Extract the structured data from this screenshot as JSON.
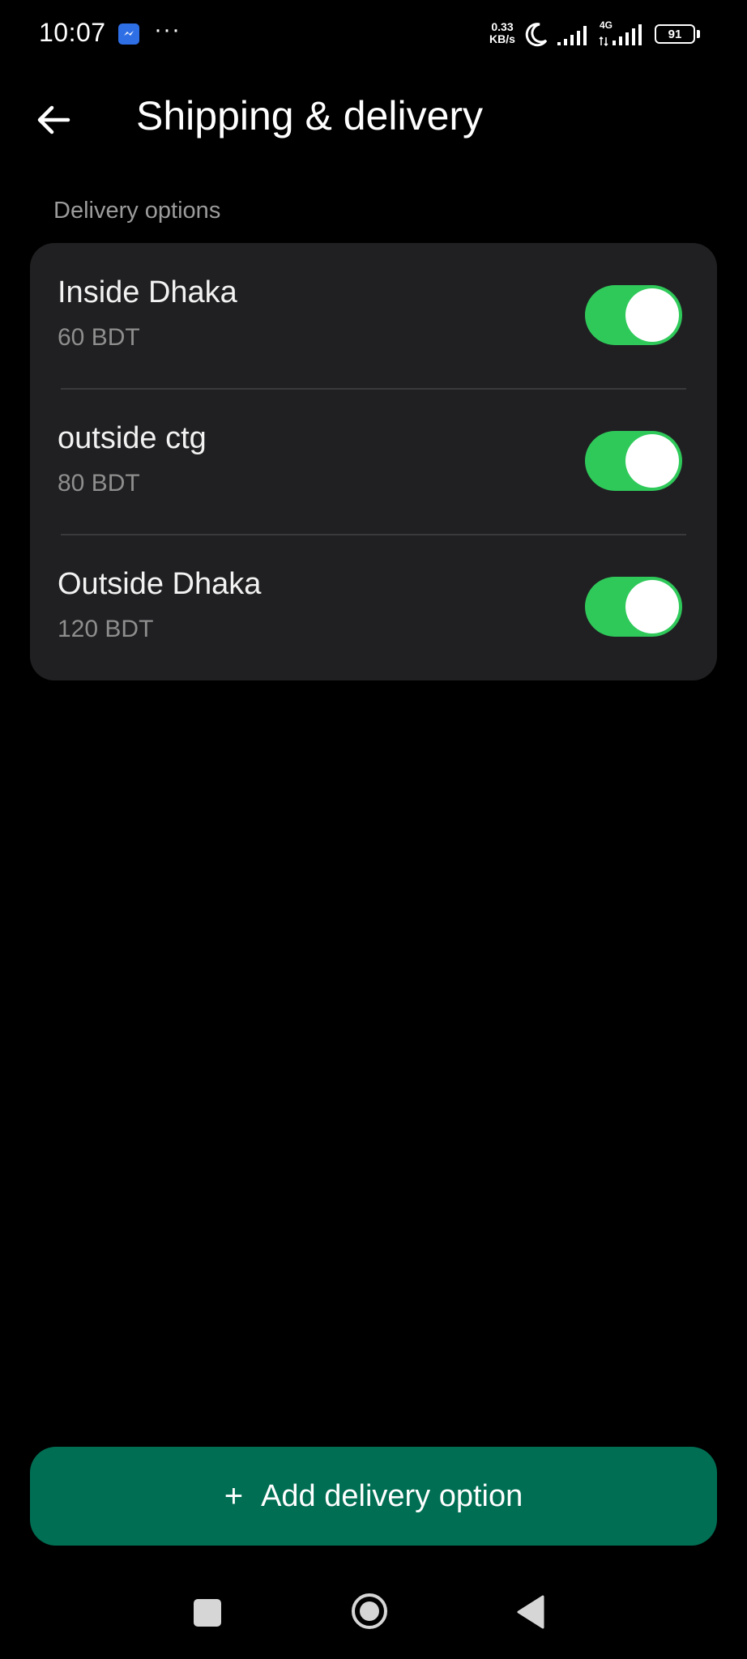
{
  "status_bar": {
    "time": "10:07",
    "more": "···",
    "net_speed_value": "0.33",
    "net_speed_unit": "KB/s",
    "net_type": "4G",
    "battery": "91"
  },
  "header": {
    "title": "Shipping & delivery"
  },
  "delivery": {
    "section_label": "Delivery options",
    "options": [
      {
        "name": "Inside Dhaka",
        "price": "60 BDT",
        "enabled": true
      },
      {
        "name": "outside ctg",
        "price": "80 BDT",
        "enabled": true
      },
      {
        "name": "Outside Dhaka",
        "price": "120 BDT",
        "enabled": true
      }
    ]
  },
  "actions": {
    "add_plus": "+",
    "add_label": "Add delivery option"
  },
  "colors": {
    "background": "#000000",
    "card": "#202022",
    "toggle_on": "#2fc95a",
    "primary_button": "#006e53",
    "secondary_text": "#8e8e8e"
  },
  "icons": {
    "back": "arrow-left-icon",
    "messenger": "messenger-icon",
    "moon": "moon-icon",
    "signal": "signal-icon",
    "battery": "battery-icon",
    "nav_recents": "square-icon",
    "nav_home": "circle-icon",
    "nav_back": "triangle-icon"
  }
}
